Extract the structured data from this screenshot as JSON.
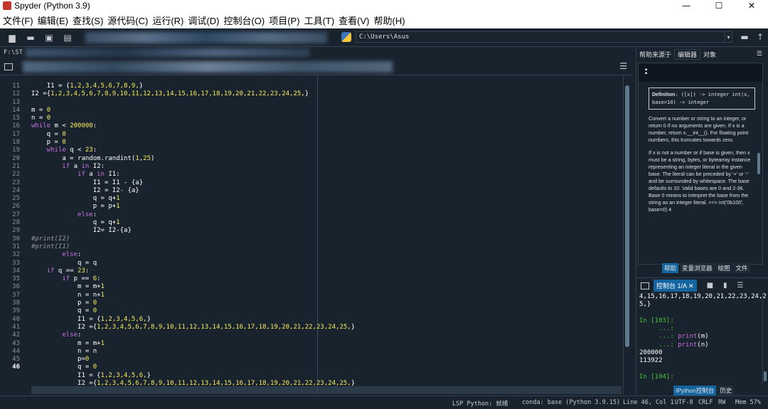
{
  "window": {
    "title": "Spyder (Python 3.9)",
    "minimize": "—",
    "maximize": "☐",
    "close": "✕"
  },
  "menubar": {
    "items": [
      "文件(F)",
      "编辑(E)",
      "查找(S)",
      "源代码(C)",
      "运行(R)",
      "调试(D)",
      "控制台(O)",
      "项目(P)",
      "工具(T)",
      "查看(V)",
      "帮助(H)"
    ]
  },
  "toolbar": {
    "path": "C:\\Users\\Asus"
  },
  "editor": {
    "path_prefix": "F:\\ST",
    "code_lines": [
      {
        "n": "",
        "html": "    <span class=\"tx\">I1 = {</span><span class=\"num\">1,2,3,4,5,6,7,8,9,</span><span class=\"tx\">}</span>"
      },
      {
        "n": "",
        "html": "<span class=\"tx\">I2 ={</span><span class=\"num\">1,2,3,4,5,6,7,8,9,10,11,12,13,14,15,16,17,18,19,20,21,22,23,24,25,</span><span class=\"tx\">}</span>"
      },
      {
        "n": "",
        "html": ""
      },
      {
        "n": "11",
        "html": "<span class=\"tx\">m = </span><span class=\"num\">0</span>"
      },
      {
        "n": "12",
        "html": "<span class=\"tx\">n = </span><span class=\"num\">0</span>"
      },
      {
        "n": "13",
        "html": "<span class=\"kw\">while</span><span class=\"tx\"> m &lt; </span><span class=\"num\">200000</span><span class=\"tx\">:</span>"
      },
      {
        "n": "14",
        "html": "<span class=\"tx\">    q = </span><span class=\"num\">0</span>"
      },
      {
        "n": "15",
        "html": "<span class=\"tx\">    p = </span><span class=\"num\">0</span>"
      },
      {
        "n": "16",
        "html": "<span class=\"kw\">    while</span><span class=\"tx\"> q &lt; </span><span class=\"num\">23</span><span class=\"tx\">:</span>"
      },
      {
        "n": "17",
        "html": "<span class=\"tx\">        a = random.randint(</span><span class=\"num\">1</span><span class=\"tx\">,</span><span class=\"num\">25</span><span class=\"tx\">)</span>"
      },
      {
        "n": "18",
        "html": "<span class=\"kw\">        if</span><span class=\"tx\"> a </span><span class=\"kw\">in</span><span class=\"tx\"> I2:</span>"
      },
      {
        "n": "19",
        "html": "<span class=\"kw\">            if</span><span class=\"tx\"> a </span><span class=\"kw\">in</span><span class=\"tx\"> I1:</span>"
      },
      {
        "n": "20",
        "html": "<span class=\"tx\">                I1 = I1 - {a}</span>"
      },
      {
        "n": "21",
        "html": "<span class=\"tx\">                I2 = I2- {a}</span>"
      },
      {
        "n": "22",
        "html": "<span class=\"tx\">                q = q+</span><span class=\"num\">1</span>"
      },
      {
        "n": "23",
        "html": "<span class=\"tx\">                p = p+</span><span class=\"num\">1</span>"
      },
      {
        "n": "24",
        "html": "<span class=\"kw\">            else</span><span class=\"tx\">:</span>"
      },
      {
        "n": "25",
        "html": "<span class=\"tx\">                q = q+</span><span class=\"num\">1</span>"
      },
      {
        "n": "26",
        "html": "<span class=\"tx\">                I2= I2-{a}</span>"
      },
      {
        "n": "27",
        "html": "<span class=\"cm\">#print(I2)</span>"
      },
      {
        "n": "28",
        "html": "<span class=\"cm\">#print(I1)</span>"
      },
      {
        "n": "29",
        "html": "<span class=\"kw\">        else</span><span class=\"tx\">:</span>"
      },
      {
        "n": "30",
        "html": "<span class=\"tx\">            q = q</span>"
      },
      {
        "n": "31",
        "html": "<span class=\"kw\">    if</span><span class=\"tx\"> q == </span><span class=\"num\">23</span><span class=\"tx\">:</span>"
      },
      {
        "n": "32",
        "html": "<span class=\"kw\">        if</span><span class=\"tx\"> p == </span><span class=\"num\">6</span><span class=\"tx\">:</span>"
      },
      {
        "n": "33",
        "html": "<span class=\"tx\">            m = m+</span><span class=\"num\">1</span>"
      },
      {
        "n": "34",
        "html": "<span class=\"tx\">            n = n+</span><span class=\"num\">1</span>"
      },
      {
        "n": "35",
        "html": "<span class=\"tx\">            p = </span><span class=\"num\">0</span>"
      },
      {
        "n": "36",
        "html": "<span class=\"tx\">            q = </span><span class=\"num\">0</span>"
      },
      {
        "n": "37",
        "html": "<span class=\"tx\">            I1 = {</span><span class=\"num\">1,2,3,4,5,6,</span><span class=\"tx\">}</span>"
      },
      {
        "n": "38",
        "html": "<span class=\"tx\">            I2 ={</span><span class=\"num\">1,2,3,4,5,6,7,8,9,10,11,12,13,14,15,16,17,18,19,20,21,22,23,24,25,</span><span class=\"tx\">}</span>"
      },
      {
        "n": "39",
        "html": "<span class=\"kw\">        else</span><span class=\"tx\">:</span>"
      },
      {
        "n": "40",
        "html": "<span class=\"tx\">            m = m+</span><span class=\"num\">1</span>"
      },
      {
        "n": "41",
        "html": "<span class=\"tx\">            n = n</span>"
      },
      {
        "n": "42",
        "html": "<span class=\"tx\">            p=</span><span class=\"num\">0</span>"
      },
      {
        "n": "43",
        "html": "<span class=\"tx\">            q = </span><span class=\"num\">0</span>"
      },
      {
        "n": "44",
        "html": "<span class=\"tx\">            I1 = {</span><span class=\"num\">1,2,3,4,5,6,</span><span class=\"tx\">}</span>"
      },
      {
        "n": "45",
        "html": "<span class=\"tx\">            I2 ={</span><span class=\"num\">1,2,3,4,5,6,7,8,9,10,11,12,13,14,15,16,17,18,19,20,21,22,23,24,25,</span><span class=\"tx\">}</span>"
      },
      {
        "n": "46",
        "html": ""
      }
    ],
    "current_line": "46"
  },
  "help": {
    "source_label": "帮助来源于",
    "source_value": "编辑器",
    "object_label": "对象",
    "title": ":",
    "definition_label": "Definition",
    "definition_sig": ": ([x]) -> integer int(x, base=10) -> integer",
    "paragraph1": "Convert a number or string to an integer, or return 0 if no arguments are given. If x is a number, return x.__int__(). For floating point numbers, this truncates towards zero.",
    "paragraph2": "If x is not a number or if base is given, then x must be a string, bytes, or bytearray instance representing an integer literal in the given base. The literal can be preceded by '+' or '-' and be surrounded by whitespace. The base defaults to 10. Valid bases are 0 and 2-36. Base 0 means to interpret the base from the string as an integer literal. >>> int('0b100', base=0) 4",
    "tabs": [
      "帮助",
      "变量浏览器",
      "绘图",
      "文件"
    ]
  },
  "console": {
    "tab_label": "控制台 1/A",
    "lines": [
      {
        "cls": "tx",
        "text": "4,15,16,17,18,19,20,21,22,23,24,2"
      },
      {
        "cls": "tx",
        "text": "5,}"
      },
      {
        "cls": "tx",
        "text": ""
      },
      {
        "cls": "prompt",
        "text": "In [103]:"
      },
      {
        "cls": "prompt",
        "text": "     ...:"
      },
      {
        "cls": "mix",
        "text": "     ...: print(m)"
      },
      {
        "cls": "mix",
        "text": "     ...: print(n)"
      },
      {
        "cls": "tx",
        "text": "200000"
      },
      {
        "cls": "tx",
        "text": "113922"
      },
      {
        "cls": "tx",
        "text": ""
      },
      {
        "cls": "prompt",
        "text": "In [104]:"
      }
    ],
    "tabs": [
      "IPython控制台",
      "历史"
    ]
  },
  "statusbar": {
    "lsp": "LSP Python: 就绪",
    "conda": "conda: base (Python 3.9.15)",
    "position": "Line 46, Col 1",
    "encoding": "UTF-8",
    "eol": "CRLF",
    "mode": "RW",
    "mem": "Mem 57%"
  }
}
